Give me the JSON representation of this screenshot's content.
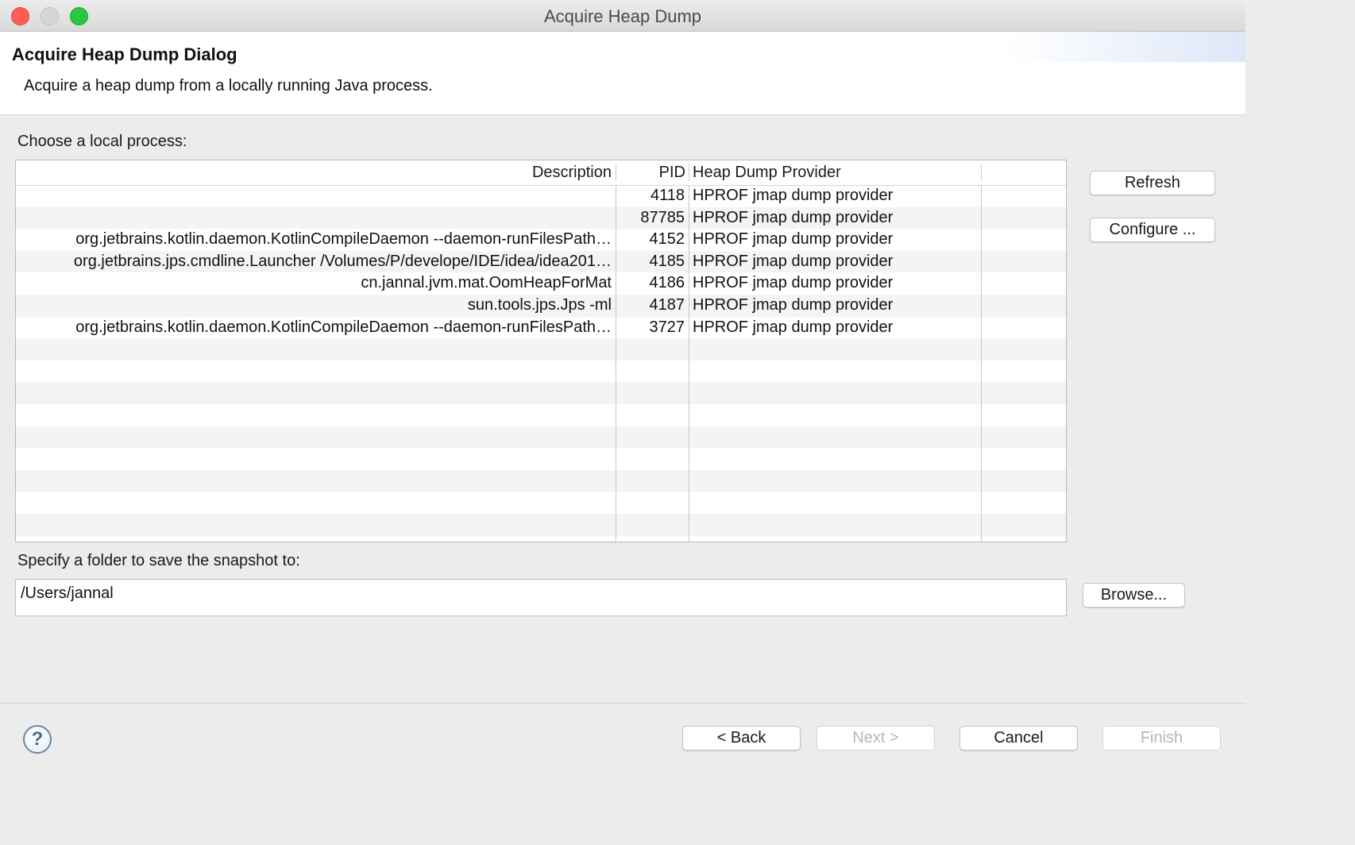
{
  "window": {
    "title": "Acquire Heap Dump"
  },
  "header": {
    "title": "Acquire Heap Dump Dialog",
    "description": "Acquire a heap dump from a locally running Java process."
  },
  "process_section": {
    "label": "Choose a local process:",
    "columns": {
      "description": "Description",
      "pid": "PID",
      "provider": "Heap Dump Provider"
    },
    "rows": [
      {
        "description": "",
        "pid": "4118",
        "provider": "HPROF jmap dump provider"
      },
      {
        "description": "",
        "pid": "87785",
        "provider": "HPROF jmap dump provider"
      },
      {
        "description": "org.jetbrains.kotlin.daemon.KotlinCompileDaemon --daemon-runFilesPath…",
        "pid": "4152",
        "provider": "HPROF jmap dump provider"
      },
      {
        "description": "org.jetbrains.jps.cmdline.Launcher /Volumes/P/develope/IDE/idea/idea201…",
        "pid": "4185",
        "provider": "HPROF jmap dump provider"
      },
      {
        "description": "cn.jannal.jvm.mat.OomHeapForMat",
        "pid": "4186",
        "provider": "HPROF jmap dump provider"
      },
      {
        "description": "sun.tools.jps.Jps -ml",
        "pid": "4187",
        "provider": "HPROF jmap dump provider"
      },
      {
        "description": "org.jetbrains.kotlin.daemon.KotlinCompileDaemon --daemon-runFilesPath…",
        "pid": "3727",
        "provider": "HPROF jmap dump provider"
      }
    ],
    "refresh_label": "Refresh",
    "configure_label": "Configure ..."
  },
  "folder_section": {
    "label": "Specify a folder to save the snapshot to:",
    "value": "/Users/jannal",
    "browse_label": "Browse..."
  },
  "footer": {
    "help_icon": "?",
    "back_label": "< Back",
    "next_label": "Next >",
    "cancel_label": "Cancel",
    "finish_label": "Finish"
  }
}
